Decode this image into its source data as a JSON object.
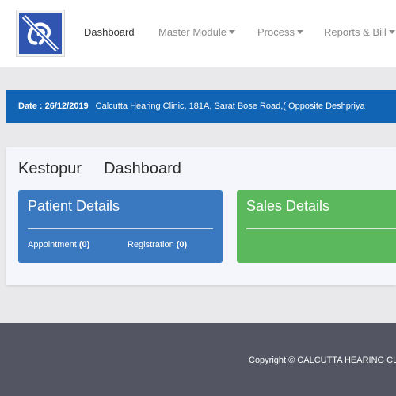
{
  "header": {
    "logo": {
      "icon": "hearing-impaired-icon",
      "bg_color": "#2f55b0"
    },
    "nav": [
      {
        "label": "Dashboard",
        "active": true
      },
      {
        "label": "Master Module",
        "dropdown": true
      },
      {
        "label": "Process",
        "dropdown": true
      },
      {
        "label": "Reports & Bill",
        "dropdown": true
      }
    ]
  },
  "info_bar": {
    "date": "Date : 26/12/2019",
    "address": "Calcutta Hearing Clinic,  181A, Sarat Bose Road,( Opposite Deshpriya",
    "color": "#1164b4"
  },
  "main": {
    "location": "Kestopur",
    "title": "Dashboard",
    "patient_panel": {
      "heading": "Patient Details",
      "color": "#3a79c0",
      "appointment_label": "Appointment",
      "appointment_count": "(0)",
      "registration_label": "Registration",
      "registration_count": "(0)"
    },
    "sales_panel": {
      "heading": "Sales Details",
      "color": "#5cb85c"
    }
  },
  "footer": {
    "copyright": "Copyright © CALCUTTA HEARING CLINIC"
  }
}
